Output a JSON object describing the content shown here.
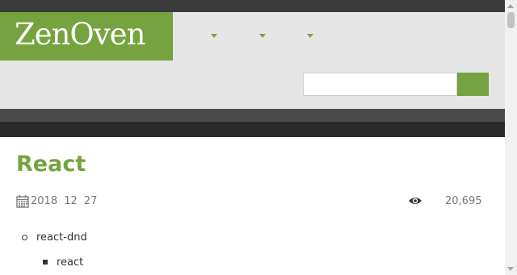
{
  "header": {
    "logo_text": "ZenOven",
    "nav_items": [
      {
        "icon": "caret-down-icon"
      },
      {
        "icon": "caret-down-icon"
      },
      {
        "icon": "caret-down-icon"
      }
    ],
    "search": {
      "value": "",
      "placeholder": ""
    }
  },
  "article": {
    "title": "React",
    "date": "2018  12  27",
    "date_icon": "calendar-icon",
    "views_icon": "eye-icon",
    "views": "20,695",
    "toc": [
      {
        "label": "react-dnd",
        "level": 1
      },
      {
        "label": "react",
        "level": 2
      }
    ]
  },
  "colors": {
    "accent": "#75a33f",
    "topbar": "#3a3a3a",
    "header_bg": "#e6e6e6",
    "band_light": "#4a4a4a",
    "band_dark": "#2b2b2b",
    "meta_text": "#777777"
  }
}
